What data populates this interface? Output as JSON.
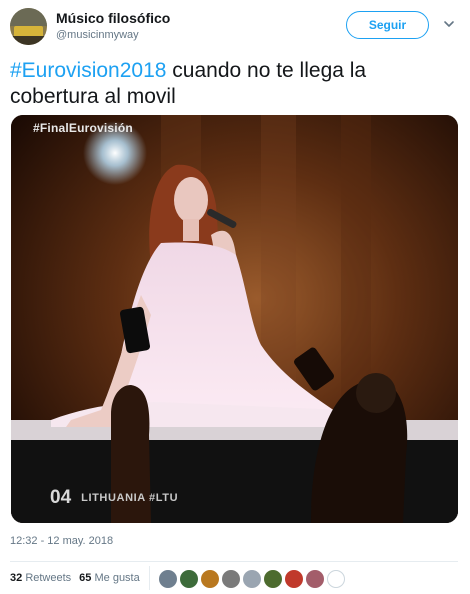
{
  "tweet": {
    "display_name": "Músico filosófico",
    "handle": "@musicinmyway",
    "follow_label": "Seguir",
    "hashtag": "#Eurovision2018",
    "text": " cuando no te llega la cobertura al movil",
    "timestamp": "12:32 - 12 may. 2018"
  },
  "media": {
    "broadcast_tag": "#FinalEurovisión",
    "performer_number": "04",
    "performer_country": "LITHUANIA #LTU"
  },
  "stats": {
    "retweets_count": "32",
    "retweets_label": "Retweets",
    "likes_count": "65",
    "likes_label": "Me gusta"
  },
  "likers": [
    {
      "name": "liker-avatar-1",
      "color": "#6f7f8f"
    },
    {
      "name": "liker-avatar-2",
      "color": "#3d6b3a"
    },
    {
      "name": "liker-avatar-3",
      "color": "#b9781f"
    },
    {
      "name": "liker-avatar-4",
      "color": "#7a7a7a"
    },
    {
      "name": "liker-avatar-5",
      "color": "#9aa5b1"
    },
    {
      "name": "liker-avatar-6",
      "color": "#4d6b2e"
    },
    {
      "name": "liker-avatar-7",
      "color": "#c0392b"
    },
    {
      "name": "liker-avatar-8",
      "color": "#a35d6a"
    },
    {
      "name": "liker-avatar-9",
      "color": "#ffffff"
    }
  ],
  "colors": {
    "accent": "#1da1f2",
    "text_primary": "#14171a",
    "text_secondary": "#657786"
  }
}
